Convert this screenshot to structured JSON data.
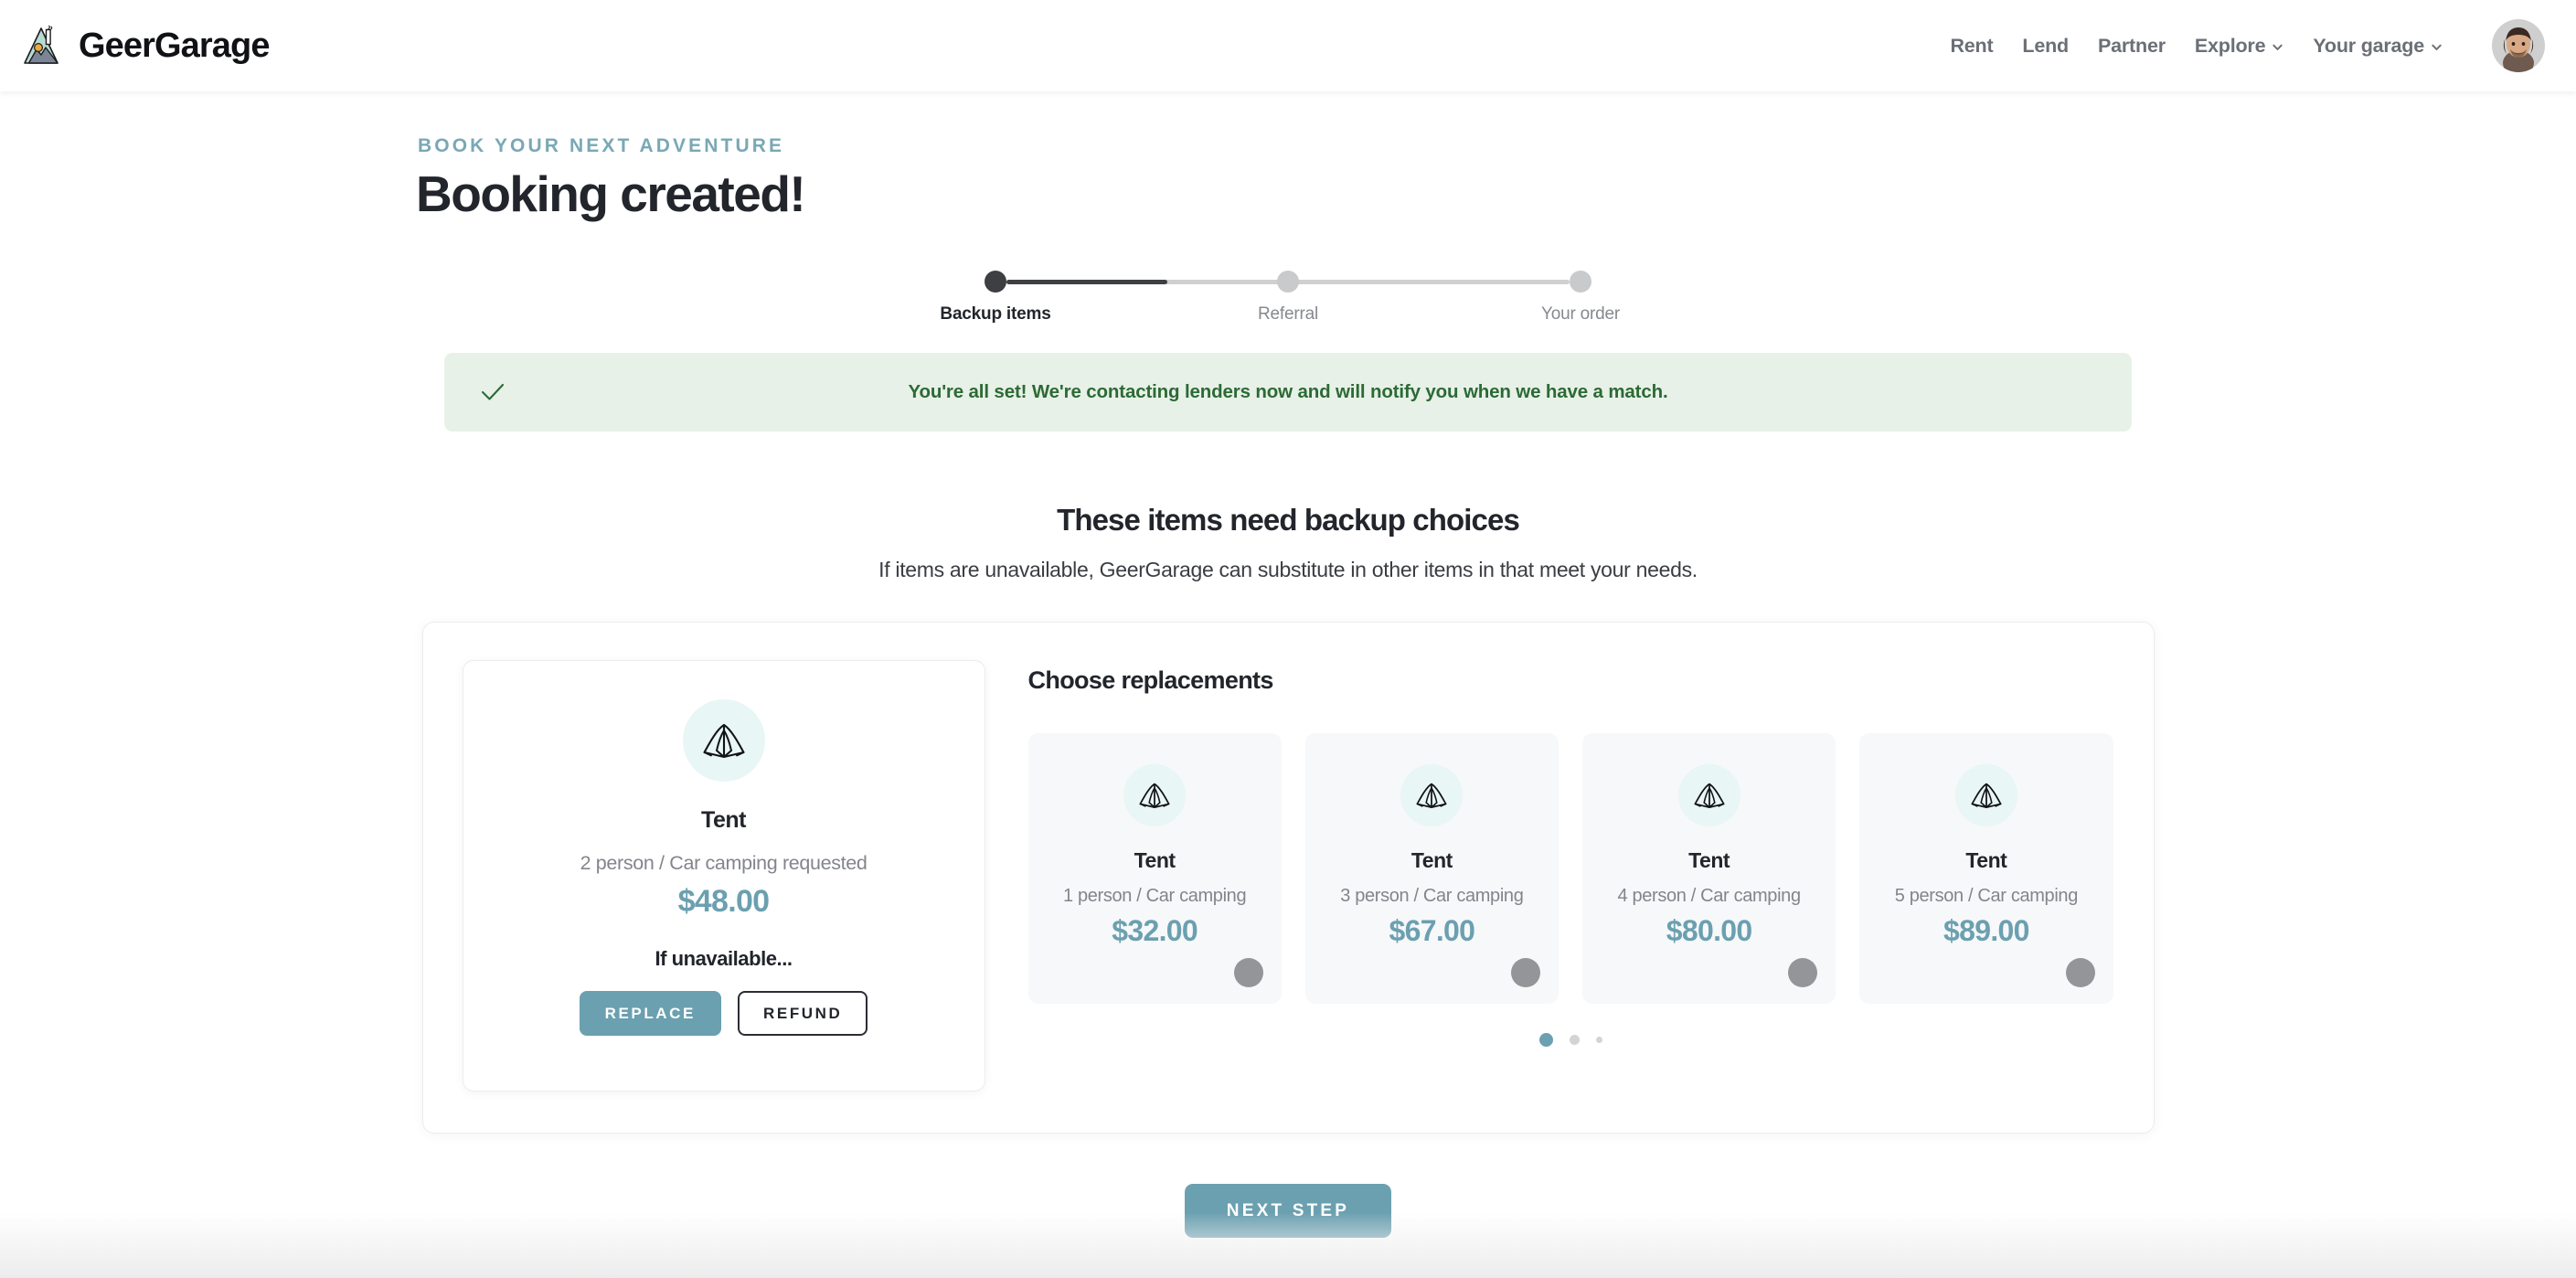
{
  "header": {
    "brand_name": "GeerGarage",
    "logo_icon": "mountain-volcano-icon",
    "nav": [
      {
        "label": "Rent",
        "has_caret": false
      },
      {
        "label": "Lend",
        "has_caret": false
      },
      {
        "label": "Partner",
        "has_caret": false
      },
      {
        "label": "Explore",
        "has_caret": true
      },
      {
        "label": "Your garage",
        "has_caret": true
      }
    ],
    "avatar_icon": "user-avatar-photo"
  },
  "hero": {
    "eyebrow": "BOOK YOUR NEXT ADVENTURE",
    "headline": "Booking created!"
  },
  "stepper": {
    "steps": [
      {
        "label": "Backup items",
        "state": "current"
      },
      {
        "label": "Referral",
        "state": "upcoming"
      },
      {
        "label": "Your order",
        "state": "upcoming"
      }
    ],
    "fill_percent": 28.5
  },
  "alert": {
    "icon": "check-icon",
    "message": "You're all set! We're contacting lenders now and will notify you when we have a match.",
    "background": "#e7f1e8",
    "text_color": "#2c6a34"
  },
  "section": {
    "title": "These items need backup choices",
    "subtitle": "If items are unavailable, GeerGarage can substitute in other items in that meet your needs."
  },
  "requested_item": {
    "icon": "tent-icon",
    "name": "Tent",
    "spec": "2 person / Car camping requested",
    "price": "$48.00",
    "unavailable_label": "If unavailable...",
    "replace_label": "REPLACE",
    "refund_label": "REFUND"
  },
  "replacements": {
    "title": "Choose replacements",
    "cards": [
      {
        "icon": "tent-icon",
        "name": "Tent",
        "spec": "1 person / Car camping",
        "price": "$32.00",
        "selected": false
      },
      {
        "icon": "tent-icon",
        "name": "Tent",
        "spec": "3 person / Car camping",
        "price": "$67.00",
        "selected": false
      },
      {
        "icon": "tent-icon",
        "name": "Tent",
        "spec": "4 person / Car camping",
        "price": "$80.00",
        "selected": false
      },
      {
        "icon": "tent-icon",
        "name": "Tent",
        "spec": "5 person / Car camping",
        "price": "$89.00",
        "selected": false
      }
    ],
    "pagination": {
      "count": 3,
      "active_index": 0
    }
  },
  "footer_action": {
    "next_label": "NEXT STEP"
  },
  "colors": {
    "accent": "#6ba0b0",
    "eyebrow": "#79a8b5",
    "ink": "#22252b",
    "muted": "#82858b",
    "card_bg": "#f7f8f9",
    "icon_bubble": "#e8f6f5",
    "radio_gray": "#939598",
    "step_done": "#3d3f43",
    "step_todo": "#c9cacb"
  }
}
